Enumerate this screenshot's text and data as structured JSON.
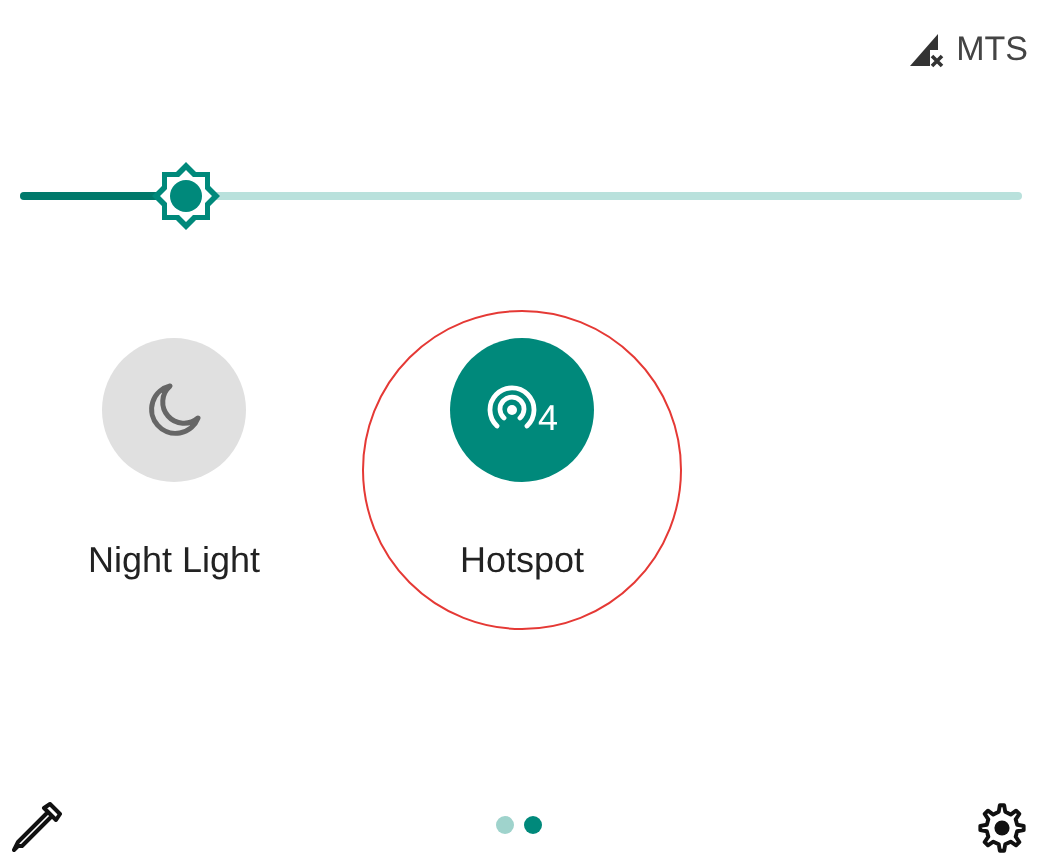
{
  "status_bar": {
    "carrier": "MTS"
  },
  "brightness": {
    "level": 0.166
  },
  "tiles": [
    {
      "kind": "night_light",
      "label": "Night Light",
      "on": false,
      "highlighted": false
    },
    {
      "kind": "hotspot",
      "label": "Hotspot",
      "on": true,
      "badge": "4",
      "highlighted": true
    }
  ],
  "pages": [
    {
      "selected": false
    },
    {
      "selected": true
    }
  ]
}
